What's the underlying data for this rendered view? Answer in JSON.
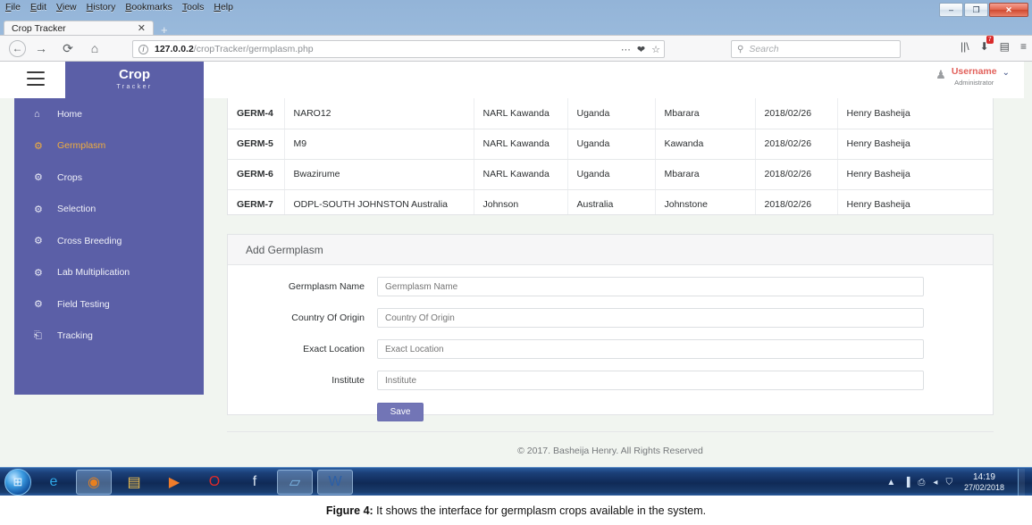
{
  "os": {
    "menubar": [
      "File",
      "Edit",
      "View",
      "History",
      "Bookmarks",
      "Tools",
      "Help"
    ],
    "window_controls": {
      "minimize": "–",
      "maximize": "❐",
      "close": "✕"
    }
  },
  "browser": {
    "tab_title": "Crop Tracker",
    "tab_close": "✕",
    "new_tab": "+",
    "nav": {
      "back": "←",
      "forward": "→",
      "reload": "⟳",
      "home": "⌂"
    },
    "url": {
      "info_glyph": "i",
      "prefix": "127.0.0.2",
      "suffix": "/cropTracker/germplasm.php"
    },
    "url_icons": {
      "more": "⋯",
      "pocket": "❤",
      "bookmark": "☆"
    },
    "search": {
      "icon": "⚲",
      "placeholder": "Search"
    },
    "toolbar": {
      "library": "||\\",
      "downloads": "⬇",
      "download_badge": "7",
      "sidebar": "▤",
      "menu": "≡"
    }
  },
  "app": {
    "hamburger": "menu-icon",
    "brand_main": "Crop",
    "brand_sub": "Tracker",
    "user": {
      "name": "Username",
      "role": "Administrator",
      "caret": "⌄",
      "avatar": "♟"
    }
  },
  "sidebar": {
    "items": [
      {
        "label": "Home",
        "icon": "⌂",
        "active": false
      },
      {
        "label": "Germplasm",
        "icon": "⚙",
        "active": true
      },
      {
        "label": "Crops",
        "icon": "⚙",
        "active": false
      },
      {
        "label": "Selection",
        "icon": "⚙",
        "active": false
      },
      {
        "label": "Cross Breeding",
        "icon": "⚙",
        "active": false
      },
      {
        "label": "Lab Multiplication",
        "icon": "⚙",
        "active": false
      },
      {
        "label": "Field Testing",
        "icon": "⚙",
        "active": false
      },
      {
        "label": "Tracking",
        "icon": "⎗",
        "active": false
      }
    ]
  },
  "table": {
    "rows": [
      {
        "code": "GERM-4",
        "name": "NARO12",
        "institute": "NARL Kawanda",
        "country": "Uganda",
        "location": "Mbarara",
        "date": "2018/02/26",
        "user": "Henry Basheija"
      },
      {
        "code": "GERM-5",
        "name": "M9",
        "institute": "NARL Kawanda",
        "country": "Uganda",
        "location": "Kawanda",
        "date": "2018/02/26",
        "user": "Henry Basheija"
      },
      {
        "code": "GERM-6",
        "name": "Bwazirume",
        "institute": "NARL Kawanda",
        "country": "Uganda",
        "location": "Mbarara",
        "date": "2018/02/26",
        "user": "Henry Basheija"
      },
      {
        "code": "GERM-7",
        "name": "ODPL-SOUTH JOHNSTON Australia",
        "institute": "Johnson",
        "country": "Australia",
        "location": "Johnstone",
        "date": "2018/02/26",
        "user": "Henry Basheija"
      }
    ]
  },
  "form": {
    "title": "Add Germplasm",
    "fields": [
      {
        "label": "Germplasm Name",
        "placeholder": "Germplasm Name",
        "value": ""
      },
      {
        "label": "Country Of Origin",
        "placeholder": "Country Of Origin",
        "value": ""
      },
      {
        "label": "Exact Location",
        "placeholder": "Exact Location",
        "value": ""
      },
      {
        "label": "Institute",
        "placeholder": "Institute",
        "value": ""
      }
    ],
    "save_label": "Save"
  },
  "footer": {
    "text": "© 2017. Basheija Henry. All Rights Reserved"
  },
  "taskbar": {
    "start": "⊞",
    "items": [
      {
        "name": "internet-explorer",
        "glyph": "e",
        "color": "#2fa8e8",
        "pinned": false
      },
      {
        "name": "firefox",
        "glyph": "◉",
        "color": "#e8801f",
        "pinned": true
      },
      {
        "name": "file-explorer",
        "glyph": "▤",
        "color": "#f2c14e",
        "pinned": false
      },
      {
        "name": "media-player",
        "glyph": "▶",
        "color": "#f07c2a",
        "pinned": false
      },
      {
        "name": "opera",
        "glyph": "O",
        "color": "#e02a2a",
        "pinned": false
      },
      {
        "name": "facebook",
        "glyph": "f",
        "color": "#dbe6f2",
        "pinned": false
      },
      {
        "name": "notepad",
        "glyph": "▱",
        "color": "#7fb9e8",
        "pinned": true
      },
      {
        "name": "word",
        "glyph": "W",
        "color": "#2b5fa8",
        "pinned": true
      }
    ],
    "tray": {
      "expand": "▲",
      "network": "▐",
      "action": "⎙",
      "volume": "◂",
      "security": "⛉"
    },
    "clock": {
      "time": "14:19",
      "date": "27/02/2018"
    }
  },
  "caption": {
    "label": "Figure 4:",
    "text": " It shows the interface for germplasm crops available in the system."
  },
  "colors": {
    "brand_purple": "#5b5fa7",
    "accent_orange": "#f0ad3e",
    "user_red": "#e2605a",
    "page_bg": "#f1f5f0"
  }
}
